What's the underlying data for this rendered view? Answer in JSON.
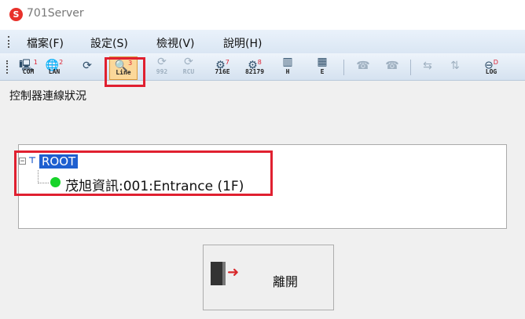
{
  "app": {
    "logo_letter": "S",
    "title": "701Server"
  },
  "menu": [
    "檔案(F)",
    "設定(S)",
    "檢視(V)",
    "說明(H)"
  ],
  "toolbar": [
    {
      "icon": "🖳",
      "badge": "1",
      "label": "COM",
      "state": "normal"
    },
    {
      "icon": "🌐",
      "badge": "2",
      "label": "LAN",
      "state": "normal"
    },
    {
      "icon": "⟳",
      "badge": "",
      "label": "",
      "state": "normal"
    },
    {
      "icon": "🔍",
      "badge": "3",
      "label": "Line",
      "state": "selected"
    },
    {
      "icon": "⟳",
      "badge": "",
      "label": "992",
      "state": "disabled"
    },
    {
      "icon": "⟳",
      "badge": "",
      "label": "RCU",
      "state": "disabled"
    },
    {
      "icon": "⚙",
      "badge": "7",
      "label": "716E",
      "state": "normal"
    },
    {
      "icon": "⚙",
      "badge": "8",
      "label": "82179",
      "state": "normal"
    },
    {
      "icon": "▥",
      "badge": "",
      "label": "H",
      "state": "normal"
    },
    {
      "icon": "▦",
      "badge": "",
      "label": "E",
      "state": "normal"
    },
    {
      "icon": "☎",
      "badge": "",
      "label": "",
      "state": "disabled"
    },
    {
      "icon": "☎",
      "badge": "",
      "label": "",
      "state": "disabled"
    },
    {
      "icon": "⇆",
      "badge": "",
      "label": "",
      "state": "disabled"
    },
    {
      "icon": "⇅",
      "badge": "",
      "label": "",
      "state": "disabled"
    },
    {
      "icon": "⊖",
      "badge": "D",
      "label": "LOG",
      "state": "normal"
    }
  ],
  "status_label": "控制器連線狀況",
  "tree": {
    "root": "ROOT",
    "child": "茂旭資訊:001:Entrance (1F)",
    "child_status_color": "#17d32a"
  },
  "exit_button": {
    "label": "離開"
  },
  "accent_color": "#e02030"
}
